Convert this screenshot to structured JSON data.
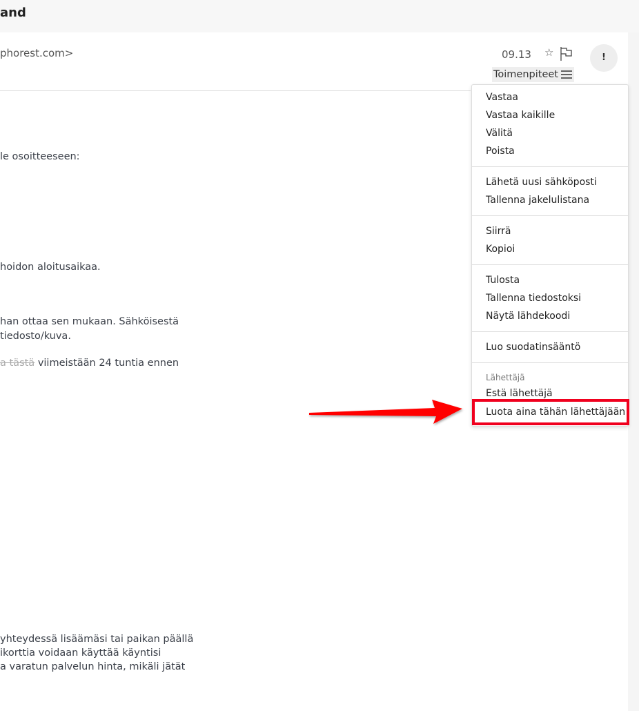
{
  "header": {
    "title": "and"
  },
  "message": {
    "from": "phorest.com>",
    "date": "09.13",
    "actions_label": "Toimenpiteet",
    "importance_label": "!",
    "body_lines": [
      "le osoitteeseen:",
      "hoidon aloitusaikaa.",
      "han ottaa sen mukaan. Sähköisestä",
      "tiedosto/kuva.",
      "viimeistään 24 tuntia ennen",
      "yhteydessä lisäämäsi tai paikan päällä",
      "ikorttia voidaan käyttää käyntisi",
      "a varatun palvelun hinta, mikäli jätät"
    ],
    "strike_text": "a tästä"
  },
  "menu": {
    "items": [
      "Vastaa",
      "Vastaa kaikille",
      "Välitä",
      "Poista",
      "Lähetä uusi sähköposti",
      "Tallenna jakelulistana",
      "Siirrä",
      "Kopioi",
      "Tulosta",
      "Tallenna tiedostoksi",
      "Näytä lähdekoodi",
      "Luo suodatinsääntö",
      "Estä lähettäjä",
      "Luota aina tähän lähettäjään"
    ],
    "section_header": "Lähettäjä",
    "highlighted_item": "Luota aina tähän lähettäjään"
  },
  "annotation": {
    "color": "#f0001e",
    "icon": "red-arrow"
  }
}
